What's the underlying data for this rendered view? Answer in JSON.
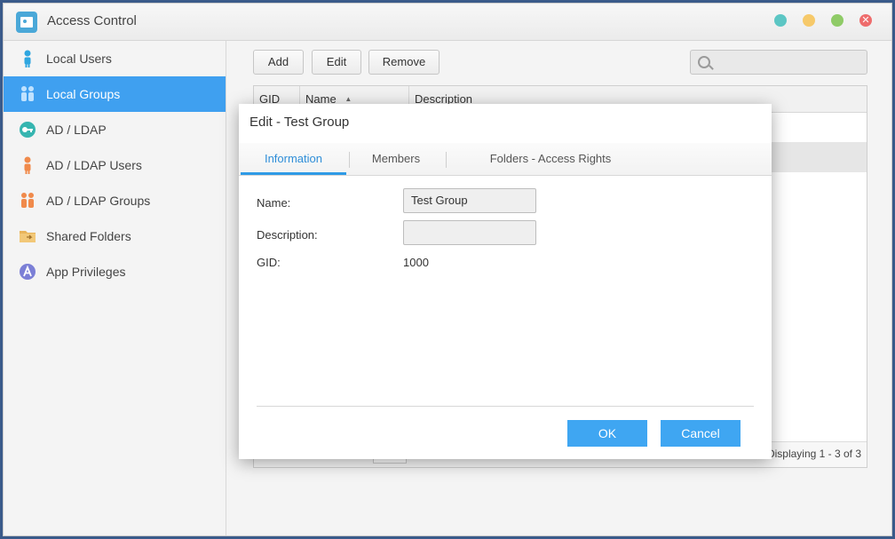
{
  "window": {
    "title": "Access Control"
  },
  "sidebar": {
    "items": [
      {
        "label": "Local Users",
        "icon": "user-icon",
        "active": false
      },
      {
        "label": "Local Groups",
        "icon": "group-icon",
        "active": true
      },
      {
        "label": "AD / LDAP",
        "icon": "key-icon",
        "active": false
      },
      {
        "label": "AD / LDAP Users",
        "icon": "user-icon",
        "active": false
      },
      {
        "label": "AD / LDAP Groups",
        "icon": "group-icon",
        "active": false
      },
      {
        "label": "Shared Folders",
        "icon": "folder-icon",
        "active": false
      },
      {
        "label": "App Privileges",
        "icon": "app-icon",
        "active": false
      }
    ]
  },
  "toolbar": {
    "add_label": "Add",
    "edit_label": "Edit",
    "remove_label": "Remove",
    "search_placeholder": ""
  },
  "grid": {
    "columns": [
      "GID",
      "Name",
      "Description"
    ],
    "sort_indicator": "▲",
    "display_info": "Displaying 1 - 3 of 3"
  },
  "dialog": {
    "title": "Edit - Test Group",
    "tabs": [
      "Information",
      "Members",
      "Folders - Access Rights"
    ],
    "active_tab": "Information",
    "fields": {
      "name_label": "Name:",
      "name_value": "Test Group",
      "description_label": "Description:",
      "description_value": "",
      "gid_label": "GID:",
      "gid_value": "1000"
    },
    "ok_label": "OK",
    "cancel_label": "Cancel"
  },
  "colors": {
    "accent": "#3fa0f0",
    "primary_button": "#3fa6f2"
  }
}
